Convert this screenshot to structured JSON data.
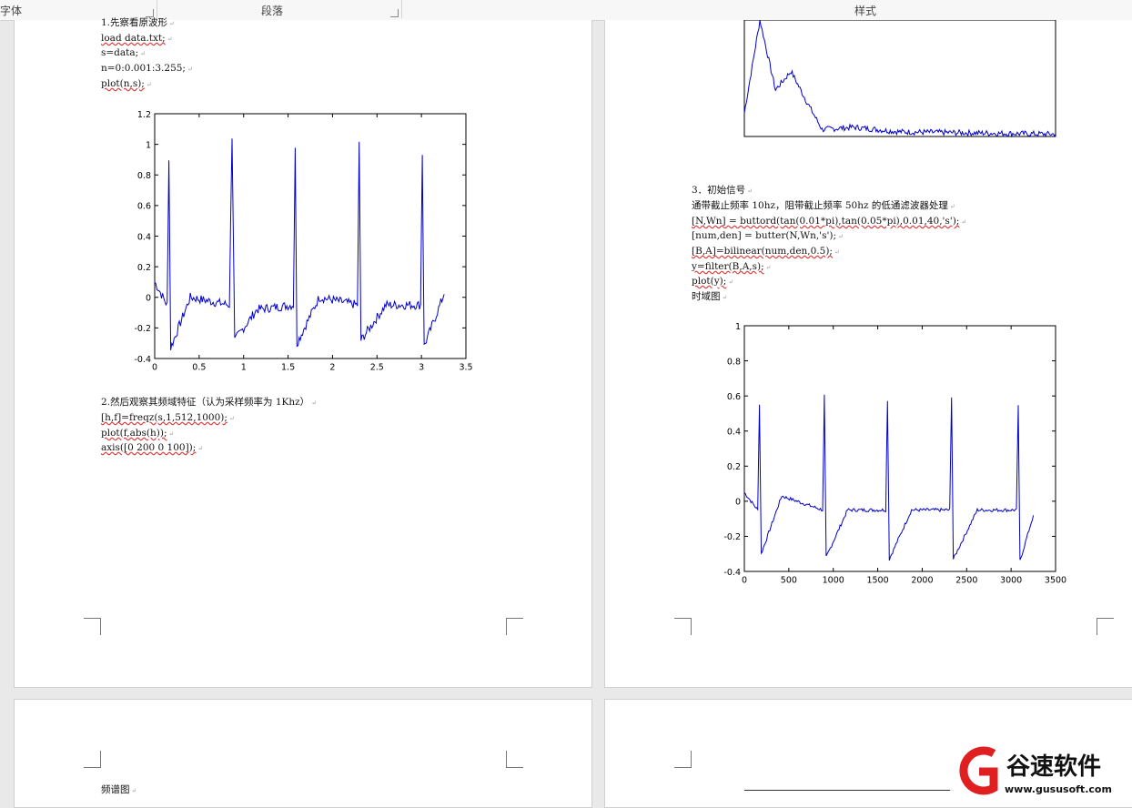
{
  "ribbon": {
    "font_group": "字体",
    "paragraph_group": "段落",
    "styles_group": "样式"
  },
  "page1": {
    "lines": [
      "1.先察看原波形",
      "load data.txt;",
      "s=data;",
      "n=0:0.001:3.255;",
      "plot(n,s);"
    ],
    "section2": [
      "2.然后观察其频域特征（认为采样频率为 1Khz）",
      "[h,f]=freqz(s,1,512,1000);",
      "plot(f,abs(h));",
      "axis([0 200 0 100]);"
    ]
  },
  "page2": {
    "lines": [
      "3．初始信号",
      "通带截止频率 10hz，阻带截止频率 50hz 的低通滤波器处理",
      "[N,Wn] = buttord(tan(0.01*pi),tan(0.05*pi),0.01,40,'s');",
      "[num,den] = butter(N,Wn,'s');",
      "[B,A]=bilinear(num,den,0.5);",
      "y=filter(B,A,s);",
      "plot(y);",
      "时域图"
    ]
  },
  "page3": {
    "label": "频谱图"
  },
  "watermark": {
    "brand": "谷速软件",
    "url": "www.gususoft.com"
  },
  "chart_data": [
    {
      "type": "line",
      "xlim": [
        0,
        3.5
      ],
      "ylim": [
        -0.4,
        1.2
      ],
      "xticks": [
        "0",
        "0.5",
        "1",
        "1.5",
        "2",
        "2.5",
        "3",
        "3.5"
      ],
      "yticks": [
        "-0.4",
        "-0.2",
        "0",
        "0.2",
        "0.4",
        "0.6",
        "0.8",
        "1",
        "1.2"
      ],
      "color": "#0000cc",
      "series": [
        {
          "x": [
            0,
            0.14,
            0.16,
            0.18,
            0.4,
            0.84,
            0.87,
            0.9,
            1.15,
            1.56,
            1.58,
            1.6,
            1.85,
            2.28,
            2.3,
            2.32,
            2.6,
            2.99,
            3.01,
            3.03,
            3.255
          ],
          "y": [
            0.1,
            -0.05,
            0.92,
            -0.33,
            0.0,
            -0.05,
            1.06,
            -0.28,
            -0.08,
            -0.05,
            0.96,
            -0.3,
            0.0,
            -0.05,
            1.0,
            -0.28,
            -0.05,
            -0.05,
            0.94,
            -0.32,
            0.02
          ]
        }
      ]
    },
    {
      "type": "line",
      "xlim": [
        0,
        200
      ],
      "ylim": [
        0,
        50
      ],
      "color": "#0000cc",
      "series": [
        {
          "x": [
            0,
            5,
            10,
            20,
            30,
            40,
            50,
            70,
            100,
            150,
            200
          ],
          "y": [
            10,
            30,
            50,
            20,
            28,
            15,
            3,
            4,
            2,
            1.5,
            1
          ]
        }
      ]
    },
    {
      "type": "line",
      "xlim": [
        0,
        3500
      ],
      "ylim": [
        -0.4,
        1
      ],
      "xticks": [
        "0",
        "500",
        "1000",
        "1500",
        "2000",
        "2500",
        "3000",
        "3500"
      ],
      "yticks": [
        "-0.4",
        "-0.2",
        "0",
        "0.2",
        "0.4",
        "0.6",
        "0.8",
        "1"
      ],
      "color": "#0000cc",
      "series": [
        {
          "x": [
            0,
            150,
            170,
            190,
            420,
            880,
            900,
            920,
            1160,
            1590,
            1610,
            1630,
            1880,
            2310,
            2330,
            2350,
            2620,
            3060,
            3080,
            3100,
            3250
          ],
          "y": [
            0.05,
            -0.05,
            0.55,
            -0.3,
            0.03,
            -0.05,
            0.6,
            -0.32,
            -0.05,
            -0.05,
            0.58,
            -0.33,
            -0.05,
            -0.05,
            0.6,
            -0.33,
            -0.05,
            -0.05,
            0.55,
            -0.34,
            -0.08
          ]
        }
      ]
    }
  ]
}
